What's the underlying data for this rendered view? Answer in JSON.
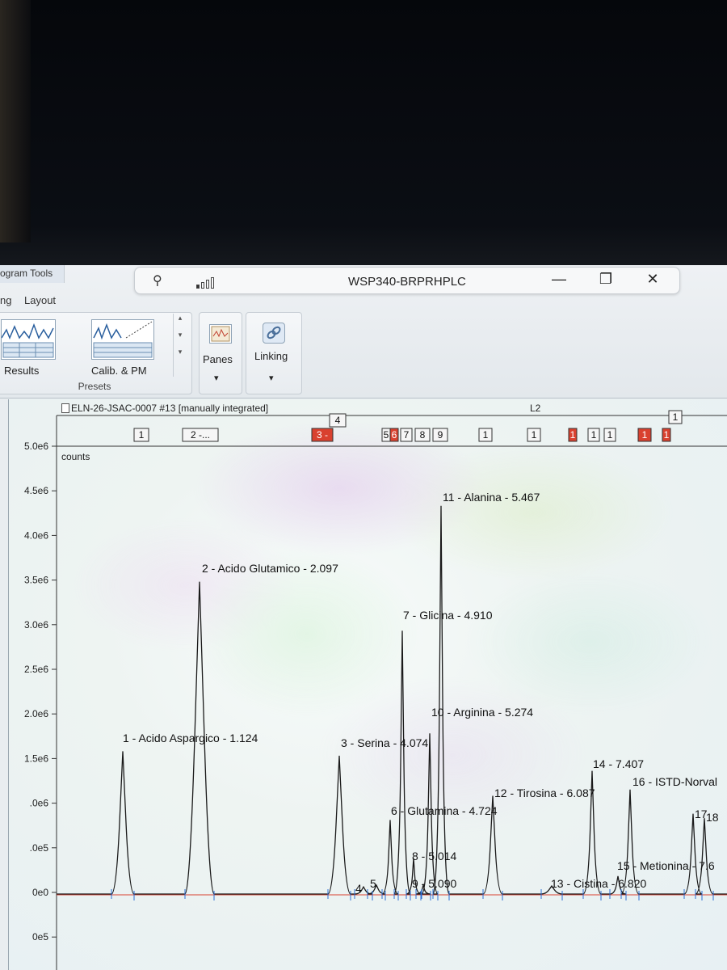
{
  "window": {
    "title": "WSP340-BRPRHPLC",
    "minimize_glyph": "—",
    "restore_glyph": "❐",
    "close_glyph": "✕"
  },
  "ribbon": {
    "context_tab": "ogram Tools",
    "tabs": [
      "ng",
      "Layout"
    ],
    "presets": {
      "group_label": "Presets",
      "results_label": "Results",
      "calib_label": "Calib. & PM"
    },
    "panes_label": "Panes",
    "linking_label": "Linking",
    "dropdown_glyph": "▾"
  },
  "chromatogram": {
    "data_title": "ELN-26-JSAC-0007 #13 [manually integrated]",
    "pane_label": "L2",
    "y_unit": "counts",
    "peak_markers": [
      {
        "text": "1",
        "style": "box"
      },
      {
        "text": "2 -...",
        "style": "box"
      },
      {
        "text": "3 -",
        "style": "red"
      },
      {
        "text": "4",
        "style": "box"
      },
      {
        "text": "5",
        "style": "box"
      },
      {
        "text": "6",
        "style": "red"
      },
      {
        "text": "7",
        "style": "box"
      },
      {
        "text": "8",
        "style": "box"
      },
      {
        "text": "9",
        "style": "box"
      },
      {
        "text": "1",
        "style": "box"
      },
      {
        "text": "1",
        "style": "box"
      },
      {
        "text": "1",
        "style": "red"
      },
      {
        "text": "1",
        "style": "box"
      },
      {
        "text": "1",
        "style": "box"
      },
      {
        "text": "1",
        "style": "red"
      },
      {
        "text": "1",
        "style": "red"
      },
      {
        "text": "1",
        "style": "box"
      }
    ]
  },
  "chart_data": {
    "type": "line",
    "ylabel": "counts",
    "y_ticks": [
      "5.0e6",
      "4.5e6",
      "4.0e6",
      "3.5e6",
      "3.0e6",
      "2.5e6",
      "2.0e6",
      "1.5e6",
      ".0e6",
      ".0e5",
      "0e0",
      "0e5"
    ],
    "ylim": [
      -500000,
      5000000
    ],
    "x_unit": "min",
    "peaks": [
      {
        "rt": 1.124,
        "height": 1600000,
        "label": "1 - Acido Aspargico - 1.124"
      },
      {
        "rt": 2.097,
        "height": 3500000,
        "label": "2 - Acido Glutamico - 2.097"
      },
      {
        "rt": 4.074,
        "height": 1550000,
        "label": "3 - Serina - 4.074"
      },
      {
        "rt": 4.25,
        "height": 80000,
        "label": "4"
      },
      {
        "rt": 4.35,
        "height": 100000,
        "label": "5"
      },
      {
        "rt": 4.724,
        "height": 830000,
        "label": "6 - Glutamina - 4.724"
      },
      {
        "rt": 4.91,
        "height": 2950000,
        "label": "7 - Glicina - 4.910"
      },
      {
        "rt": 5.014,
        "height": 400000,
        "label": "8 - 5.014"
      },
      {
        "rt": 5.09,
        "height": 100000,
        "label": "9 - 5.090"
      },
      {
        "rt": 5.274,
        "height": 1800000,
        "label": "10 - Arginina - 5.274"
      },
      {
        "rt": 5.467,
        "height": 4350000,
        "label": "11 - Alanina - 5.467"
      },
      {
        "rt": 6.087,
        "height": 1100000,
        "label": "12 - Tirosina - 6.087"
      },
      {
        "rt": 6.5,
        "height": 90000,
        "label": "13 - Cistina - 6.820"
      },
      {
        "rt": 7.407,
        "height": 1380000,
        "label": "14 - 7.407"
      },
      {
        "rt": 7.5,
        "height": 200000,
        "label": "15 - Metionina - 7.6"
      },
      {
        "rt": 7.65,
        "height": 1170000,
        "label": "16 - ISTD-Norval"
      },
      {
        "rt": 8.1,
        "height": 900000,
        "label": "17"
      },
      {
        "rt": 8.2,
        "height": 850000,
        "label": "18"
      }
    ],
    "trace_color": "#1a1a1a",
    "baseline_color": "#d9412f",
    "tick_color": "#2b6fd6"
  }
}
